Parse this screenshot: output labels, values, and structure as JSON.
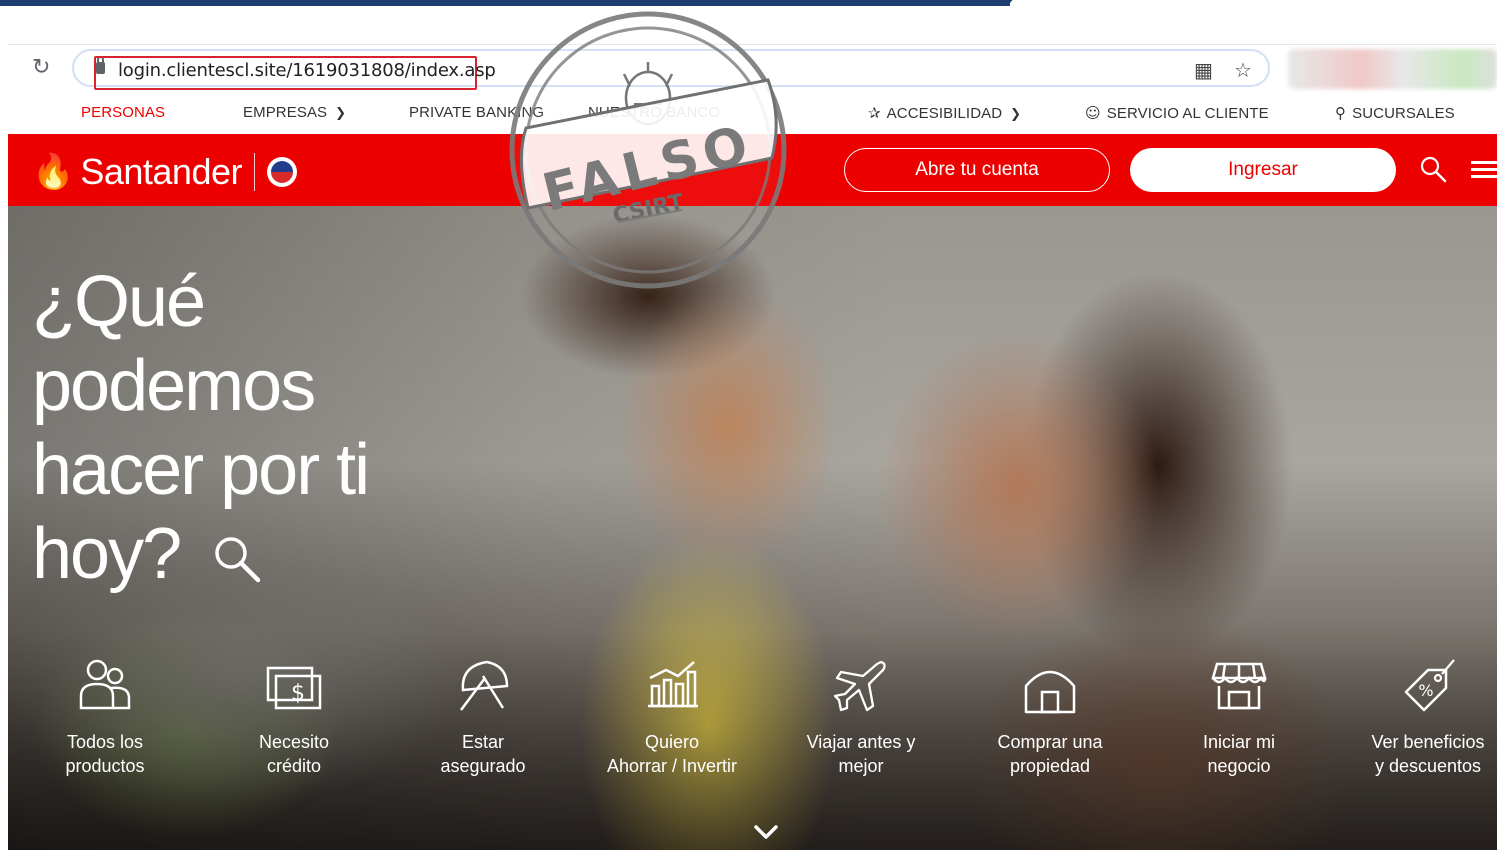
{
  "browser": {
    "url": "login.clientescl.site/1619031808/index.asp"
  },
  "util_nav": {
    "items": [
      {
        "label": "PERSONAS",
        "active": true
      },
      {
        "label": "EMPRESAS"
      },
      {
        "label": "PRIVATE BANKING"
      },
      {
        "label": "NUESTRO BANCO"
      }
    ],
    "accesibilidad": "ACCESIBILIDAD",
    "servicio": "SERVICIO AL CLIENTE",
    "sucursales": "SUCURSALES"
  },
  "header": {
    "brand": "Santander",
    "open_account": "Abre tu cuenta",
    "login": "Ingresar",
    "brand_color": "#ec0000"
  },
  "hero": {
    "headline": "¿Qué podemos hacer por ti hoy?"
  },
  "quick_links": [
    {
      "icon": "people-icon",
      "label": "Todos los\nproductos"
    },
    {
      "icon": "money-icon",
      "label": "Necesito\ncrédito"
    },
    {
      "icon": "umbrella-icon",
      "label": "Estar\nasegurado"
    },
    {
      "icon": "chart-icon",
      "label": "Quiero\nAhorrar / Invertir"
    },
    {
      "icon": "plane-icon",
      "label": "Viajar antes y\nmejor"
    },
    {
      "icon": "house-icon",
      "label": "Comprar una\npropiedad"
    },
    {
      "icon": "store-icon",
      "label": "Iniciar mi\nnegocio"
    },
    {
      "icon": "tag-icon",
      "label": "Ver beneficios\ny descuentos"
    }
  ],
  "stamp": {
    "word": "FALSO",
    "org": "CSIRT"
  }
}
